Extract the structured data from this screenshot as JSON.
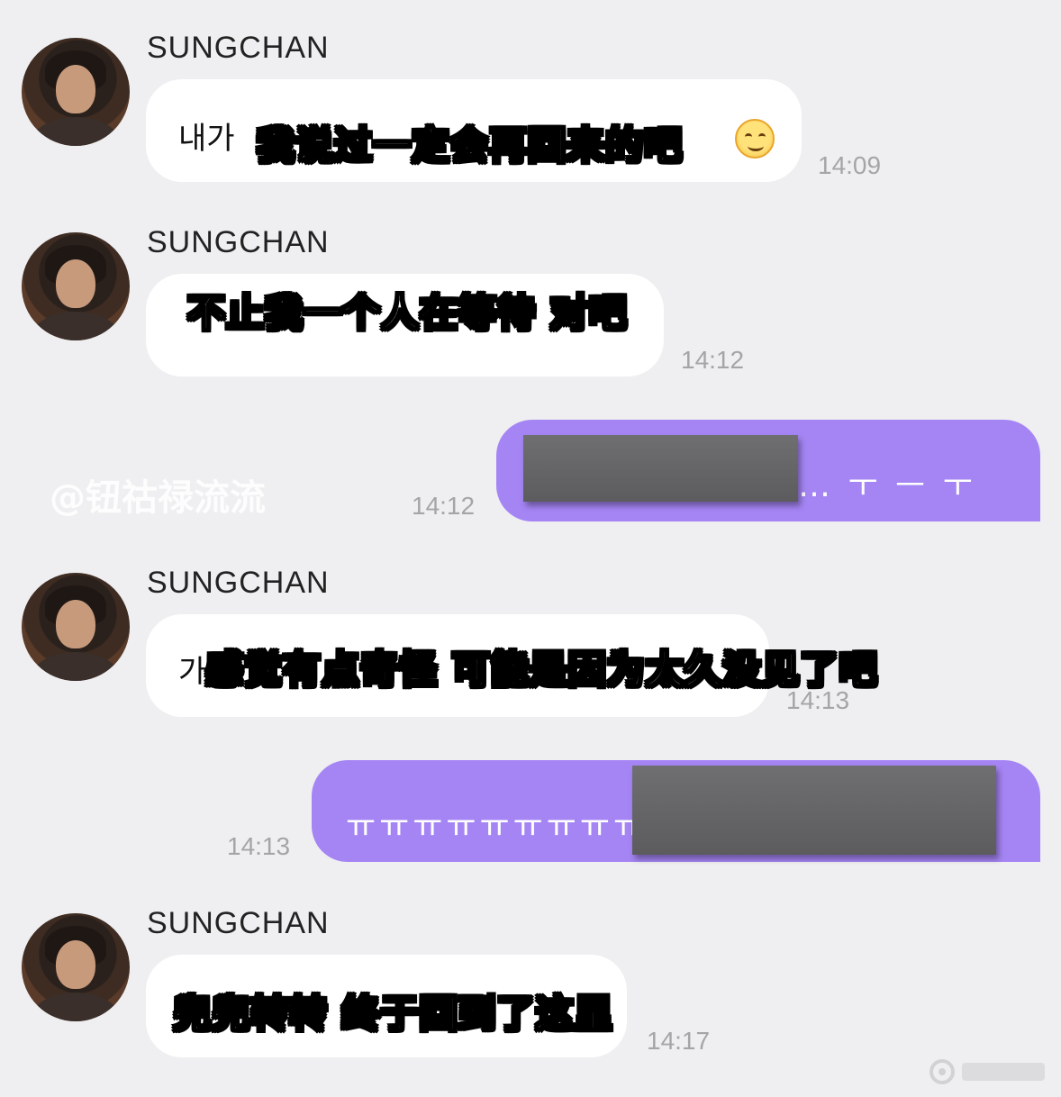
{
  "messages": [
    {
      "sender": "SUNGCHAN",
      "korean_visible": "내가",
      "caption": "我说过一定会再回来的吧",
      "time": "14:09"
    },
    {
      "sender": "SUNGCHAN",
      "caption": "不止我一个人在等待 对吧",
      "time": "14:12"
    },
    {
      "outgoing": true,
      "text_visible": "… ㅜ ㅡ ㅜ",
      "time": "14:12"
    },
    {
      "sender": "SUNGCHAN",
      "korean_visible": "가",
      "caption": "感觉有点奇怪 可能是因为太久没见了吧",
      "time": "14:13"
    },
    {
      "outgoing": true,
      "text_visible": "ㅠㅠㅠㅠㅠㅠㅠㅠㅠ",
      "time": "14:13"
    },
    {
      "sender": "SUNGCHAN",
      "caption": "兜兜转转 终于回到了这里",
      "time": "14:17"
    }
  ],
  "watermark": "@钮祜禄流流",
  "colors": {
    "background": "#efeff1",
    "incoming_bubble": "#ffffff",
    "outgoing_bubble": "#a585f4",
    "timestamp": "#a5a5a8"
  }
}
